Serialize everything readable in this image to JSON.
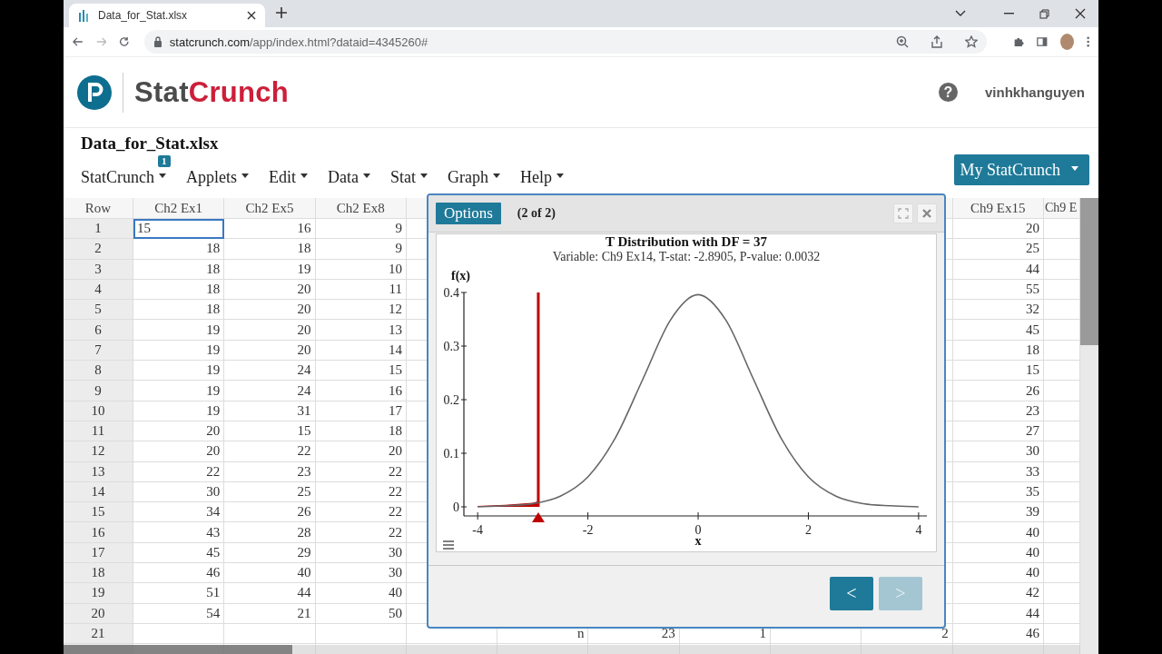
{
  "browser": {
    "tab": {
      "title": "Data_for_Stat.xlsx",
      "selected": true
    },
    "url": {
      "host": "statcrunch.com",
      "path": "/app/index.html?dataid=4345260#"
    }
  },
  "header": {
    "brand": {
      "part_1": "Stat",
      "part_2": "Crunch"
    },
    "help": "?",
    "user": "vinhkhanguyen"
  },
  "document": {
    "title": "Data_for_Stat.xlsx",
    "badge": "1",
    "menu": [
      "StatCrunch",
      "Applets",
      "Edit",
      "Data",
      "Stat",
      "Graph",
      "Help"
    ],
    "account_button": "My StatCrunch"
  },
  "table": {
    "columns": {
      "row": "Row",
      "ch2_ex1": "Ch2 Ex1",
      "ch2_ex5": "Ch2 Ex5",
      "ch2_ex8": "Ch2 Ex8",
      "ch9_ex15": "Ch9 Ex15",
      "column_12": "Ch9 E"
    },
    "rows": [
      {
        "row": "1",
        "ch2_ex1": {
          "text": "15",
          "selected": true
        },
        "ch2_ex5": {
          "text": "16",
          "selected": false
        },
        "ch2_ex8": {
          "text": "9",
          "selected": false
        },
        "ch9_ex15": {
          "text": "20",
          "selected": false
        }
      },
      {
        "row": "2",
        "ch2_ex1": {
          "text": "18",
          "selected": false
        },
        "ch2_ex5": {
          "text": "18",
          "selected": false
        },
        "ch2_ex8": {
          "text": "9",
          "selected": false
        },
        "ch9_ex15": {
          "text": "25",
          "selected": false
        }
      },
      {
        "row": "3",
        "ch2_ex1": {
          "text": "18",
          "selected": false
        },
        "ch2_ex5": {
          "text": "19",
          "selected": false
        },
        "ch2_ex8": {
          "text": "10",
          "selected": false
        },
        "ch9_ex15": {
          "text": "44",
          "selected": false
        }
      },
      {
        "row": "4",
        "ch2_ex1": {
          "text": "18",
          "selected": false
        },
        "ch2_ex5": {
          "text": "20",
          "selected": false
        },
        "ch2_ex8": {
          "text": "11",
          "selected": false
        },
        "ch9_ex15": {
          "text": "55",
          "selected": false
        }
      },
      {
        "row": "5",
        "ch2_ex1": {
          "text": "18",
          "selected": false
        },
        "ch2_ex5": {
          "text": "20",
          "selected": false
        },
        "ch2_ex8": {
          "text": "12",
          "selected": false
        },
        "ch9_ex15": {
          "text": "32",
          "selected": false
        }
      },
      {
        "row": "6",
        "ch2_ex1": {
          "text": "19",
          "selected": false
        },
        "ch2_ex5": {
          "text": "20",
          "selected": false
        },
        "ch2_ex8": {
          "text": "13",
          "selected": false
        },
        "ch9_ex15": {
          "text": "45",
          "selected": false
        }
      },
      {
        "row": "7",
        "ch2_ex1": {
          "text": "19",
          "selected": false
        },
        "ch2_ex5": {
          "text": "20",
          "selected": false
        },
        "ch2_ex8": {
          "text": "14",
          "selected": false
        },
        "ch9_ex15": {
          "text": "18",
          "selected": false
        }
      },
      {
        "row": "8",
        "ch2_ex1": {
          "text": "19",
          "selected": false
        },
        "ch2_ex5": {
          "text": "24",
          "selected": false
        },
        "ch2_ex8": {
          "text": "15",
          "selected": false
        },
        "ch9_ex15": {
          "text": "15",
          "selected": false
        }
      },
      {
        "row": "9",
        "ch2_ex1": {
          "text": "19",
          "selected": false
        },
        "ch2_ex5": {
          "text": "24",
          "selected": false
        },
        "ch2_ex8": {
          "text": "16",
          "selected": false
        },
        "ch9_ex15": {
          "text": "26",
          "selected": false
        }
      },
      {
        "row": "10",
        "ch2_ex1": {
          "text": "19",
          "selected": false
        },
        "ch2_ex5": {
          "text": "31",
          "selected": false
        },
        "ch2_ex8": {
          "text": "17",
          "selected": false
        },
        "ch9_ex15": {
          "text": "23",
          "selected": false
        }
      },
      {
        "row": "11",
        "ch2_ex1": {
          "text": "20",
          "selected": false
        },
        "ch2_ex5": {
          "text": "15",
          "selected": false
        },
        "ch2_ex8": {
          "text": "18",
          "selected": false
        },
        "ch9_ex15": {
          "text": "27",
          "selected": false
        }
      },
      {
        "row": "12",
        "ch2_ex1": {
          "text": "20",
          "selected": false
        },
        "ch2_ex5": {
          "text": "22",
          "selected": false
        },
        "ch2_ex8": {
          "text": "20",
          "selected": false
        },
        "ch9_ex15": {
          "text": "30",
          "selected": false
        }
      },
      {
        "row": "13",
        "ch2_ex1": {
          "text": "22",
          "selected": false
        },
        "ch2_ex5": {
          "text": "23",
          "selected": false
        },
        "ch2_ex8": {
          "text": "22",
          "selected": false
        },
        "ch9_ex15": {
          "text": "33",
          "selected": false
        }
      },
      {
        "row": "14",
        "ch2_ex1": {
          "text": "30",
          "selected": false
        },
        "ch2_ex5": {
          "text": "25",
          "selected": false
        },
        "ch2_ex8": {
          "text": "22",
          "selected": false
        },
        "ch9_ex15": {
          "text": "35",
          "selected": false
        }
      },
      {
        "row": "15",
        "ch2_ex1": {
          "text": "34",
          "selected": false
        },
        "ch2_ex5": {
          "text": "26",
          "selected": false
        },
        "ch2_ex8": {
          "text": "22",
          "selected": false
        },
        "ch9_ex15": {
          "text": "39",
          "selected": false
        }
      },
      {
        "row": "16",
        "ch2_ex1": {
          "text": "43",
          "selected": false
        },
        "ch2_ex5": {
          "text": "28",
          "selected": false
        },
        "ch2_ex8": {
          "text": "22",
          "selected": false
        },
        "ch9_ex15": {
          "text": "40",
          "selected": false
        }
      },
      {
        "row": "17",
        "ch2_ex1": {
          "text": "45",
          "selected": false
        },
        "ch2_ex5": {
          "text": "29",
          "selected": false
        },
        "ch2_ex8": {
          "text": "30",
          "selected": false
        },
        "ch9_ex15": {
          "text": "40",
          "selected": false
        }
      },
      {
        "row": "18",
        "ch2_ex1": {
          "text": "46",
          "selected": false
        },
        "ch2_ex5": {
          "text": "40",
          "selected": false
        },
        "ch2_ex8": {
          "text": "30",
          "selected": false
        },
        "ch9_ex15": {
          "text": "40",
          "selected": false
        }
      },
      {
        "row": "19",
        "ch2_ex1": {
          "text": "51",
          "selected": false
        },
        "ch2_ex5": {
          "text": "44",
          "selected": false
        },
        "ch2_ex8": {
          "text": "40",
          "selected": false
        },
        "ch9_ex15": {
          "text": "42",
          "selected": false
        }
      },
      {
        "row": "20",
        "ch2_ex1": {
          "text": "54",
          "selected": false
        },
        "ch2_ex5": {
          "text": "21",
          "selected": false
        },
        "ch2_ex8": {
          "text": "50",
          "selected": false
        },
        "ch9_ex15": {
          "text": "44",
          "selected": false
        }
      },
      {
        "row": "21",
        "column_6": {
          "text": "n",
          "selected": false
        },
        "column_7": {
          "text": "23",
          "selected": false
        },
        "column_8": {
          "text": "1",
          "selected": false
        },
        "column_10": {
          "text": "2",
          "selected": false
        },
        "ch9_ex15": {
          "text": "46",
          "selected": false
        }
      }
    ]
  },
  "dialog": {
    "options_button": "Options",
    "counter": "(2 of 2)",
    "subtitle": "Variable: Ch9 Ex14, T-stat: -2.8905, P-value: 0.0032",
    "chart_data": {
      "type": "line",
      "title": "T Distribution with DF = 37",
      "xlabel": "x",
      "ylabel": "f(x)",
      "x": [
        -4,
        -3.5,
        -3,
        -2.5,
        -2,
        -1.5,
        -1,
        -0.5,
        0,
        0.5,
        1,
        1.5,
        2,
        2.5,
        3,
        3.5,
        4
      ],
      "series": [
        {
          "color": "#666666",
          "values": [
            0,
            0.002,
            0.006,
            0.02,
            0.056,
            0.129,
            0.239,
            0.349,
            0.396,
            0.349,
            0.239,
            0.129,
            0.056,
            0.02,
            0.006,
            0.002,
            0
          ]
        }
      ],
      "xlim": [
        -4.25,
        4.15
      ],
      "ylim": [
        0,
        0.4
      ],
      "xticks": [
        {
          "value": -4,
          "label": "-4"
        },
        {
          "value": -2,
          "label": "-2"
        },
        {
          "value": 0,
          "label": "0"
        },
        {
          "value": 2,
          "label": "2"
        },
        {
          "value": 4,
          "label": "4"
        }
      ],
      "yticks": [
        {
          "value": 0,
          "label": "0"
        },
        {
          "value": 0.1,
          "label": "0.1"
        },
        {
          "value": 0.2,
          "label": "0.2"
        },
        {
          "value": 0.3,
          "label": "0.3"
        },
        {
          "value": 0.4,
          "label": "0.4"
        }
      ],
      "ref_lines": [
        {
          "axis": "x",
          "value": -2.9
        }
      ]
    },
    "prev_button": {
      "label": "<",
      "disabled": false
    },
    "next_button": {
      "label": ">",
      "disabled": true
    }
  }
}
